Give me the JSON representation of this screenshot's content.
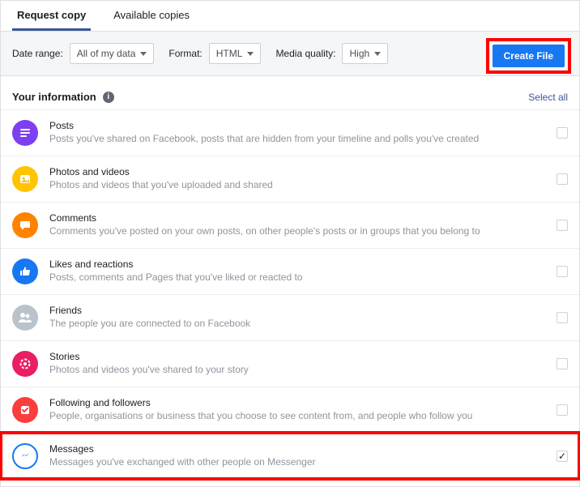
{
  "tabs": {
    "request": "Request copy",
    "available": "Available copies"
  },
  "controls": {
    "dateRangeLabel": "Date range:",
    "dateRangeValue": "All of my data",
    "formatLabel": "Format:",
    "formatValue": "HTML",
    "mediaLabel": "Media quality:",
    "mediaValue": "High",
    "createLabel": "Create File"
  },
  "sectionTitle": "Your information",
  "selectAll": "Select all",
  "items": [
    {
      "title": "Posts",
      "desc": "Posts you've shared on Facebook, posts that are hidden from your timeline and polls you've created"
    },
    {
      "title": "Photos and videos",
      "desc": "Photos and videos that you've uploaded and shared"
    },
    {
      "title": "Comments",
      "desc": "Comments you've posted on your own posts, on other people's posts or in groups that you belong to"
    },
    {
      "title": "Likes and reactions",
      "desc": "Posts, comments and Pages that you've liked or reacted to"
    },
    {
      "title": "Friends",
      "desc": "The people you are connected to on Facebook"
    },
    {
      "title": "Stories",
      "desc": "Photos and videos you've shared to your story"
    },
    {
      "title": "Following and followers",
      "desc": "People, organisations or business that you choose to see content from, and people who follow you"
    },
    {
      "title": "Messages",
      "desc": "Messages you've exchanged with other people on Messenger"
    }
  ]
}
